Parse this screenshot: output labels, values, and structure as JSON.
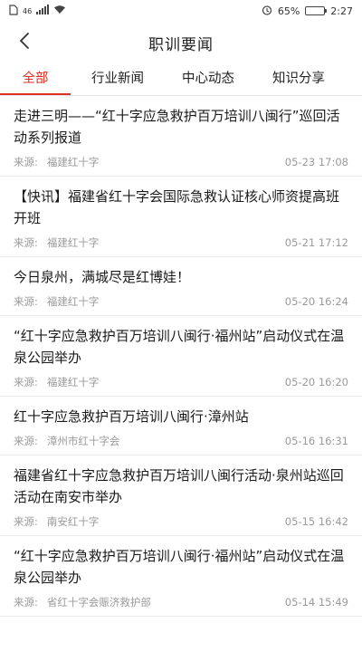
{
  "status_bar": {
    "signal_text": "46",
    "badge": "",
    "battery_percent": "65%",
    "battery_level": 0.65,
    "time": "2:27"
  },
  "header": {
    "title": "职训要闻"
  },
  "tabs": [
    {
      "label": "全部",
      "active": true
    },
    {
      "label": "行业新闻",
      "active": false
    },
    {
      "label": "中心动态",
      "active": false
    },
    {
      "label": "知识分享",
      "active": false
    }
  ],
  "source_label": "来源:",
  "news": [
    {
      "title": "走进三明——“红十字应急救护百万培训八闽行”巡回活动系列报道",
      "source": "福建红十字",
      "time": "05-23 17:08"
    },
    {
      "title": "【快讯】福建省红十字会国际急救认证核心师资提高班开班",
      "source": "福建红十字",
      "time": "05-21 17:12"
    },
    {
      "title": "今日泉州，满城尽是红博娃！",
      "source": "福建红十字",
      "time": "05-20 16:24"
    },
    {
      "title": "“红十字应急救护百万培训八闽行·福州站”启动仪式在温泉公园举办",
      "source": "福建红十字",
      "time": "05-20 16:20"
    },
    {
      "title": "红十字应急救护百万培训八闽行·漳州站",
      "source": "漳州市红十字会",
      "time": "05-16 16:31"
    },
    {
      "title": "福建省红十字应急救护百万培训八闽行活动·泉州站巡回活动在南安市举办",
      "source": "南安红十字",
      "time": "05-15 16:42"
    },
    {
      "title": "“红十字应急救护百万培训八闽行·福州站”启动仪式在温泉公园举办",
      "source": "省红十字会赈济救护部",
      "time": "05-14 15:49"
    }
  ]
}
